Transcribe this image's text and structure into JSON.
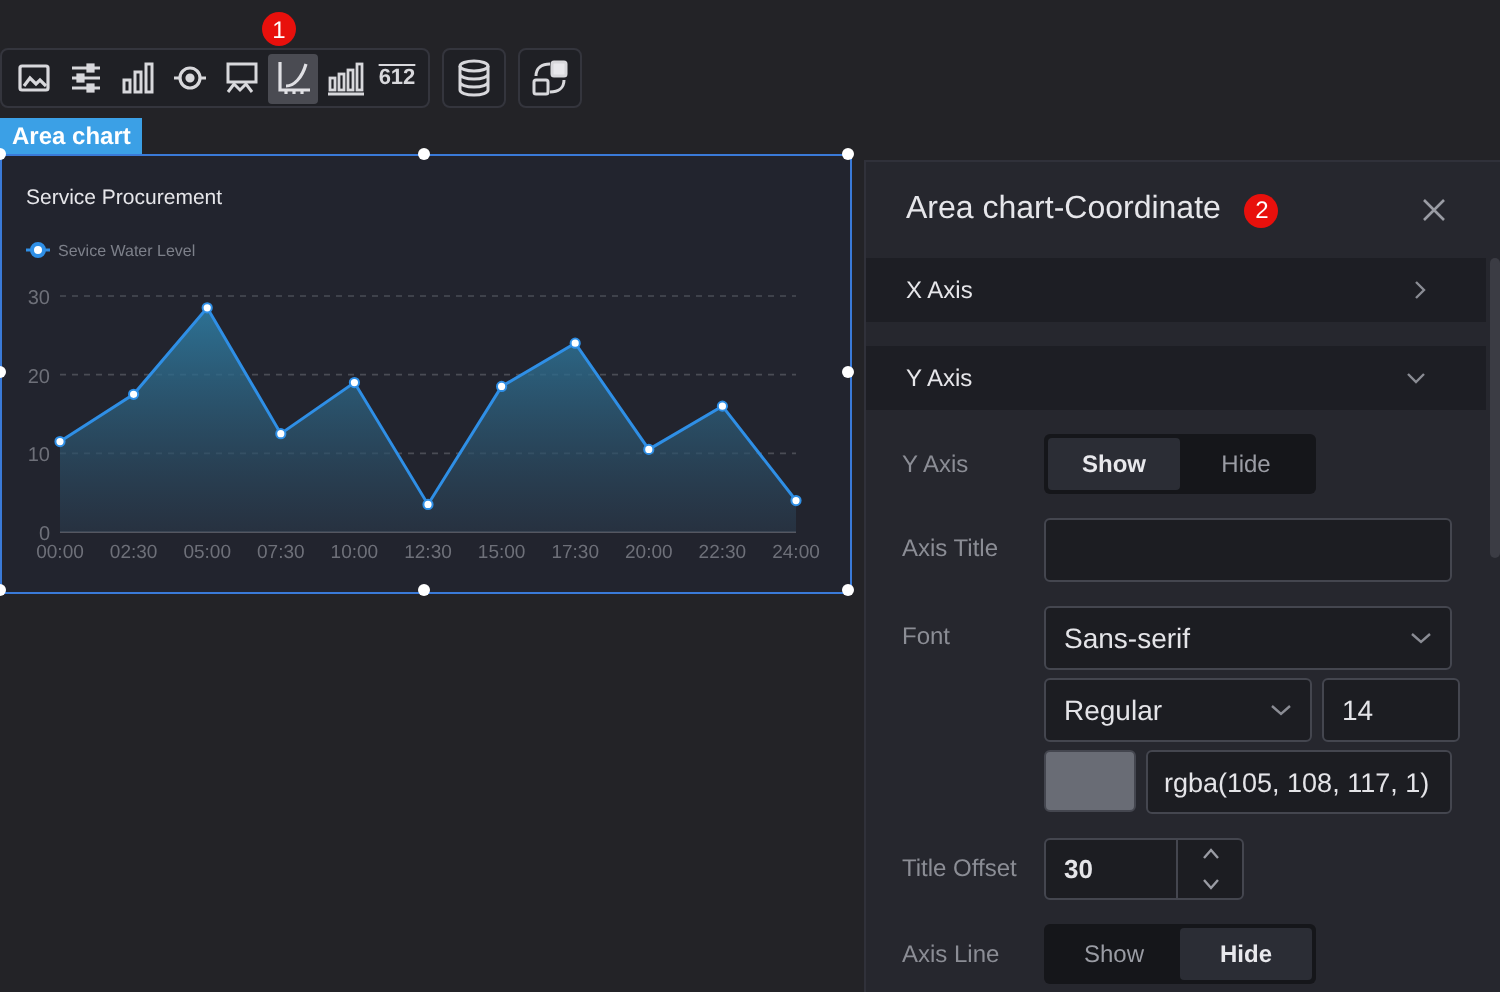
{
  "toolbar": {
    "badge": "1",
    "tools": [
      {
        "kind": "image",
        "selected": false
      },
      {
        "kind": "sliders",
        "selected": false
      },
      {
        "kind": "bars",
        "selected": false
      },
      {
        "kind": "target",
        "selected": false
      },
      {
        "kind": "screen",
        "selected": false
      },
      {
        "kind": "area",
        "selected": true
      },
      {
        "kind": "histogram",
        "selected": false
      },
      {
        "kind": "number",
        "label": "612",
        "selected": false
      }
    ],
    "extra_tools": [
      {
        "kind": "database"
      },
      {
        "kind": "link"
      }
    ]
  },
  "component_label": "Area chart",
  "chart": {
    "chart_data": {
      "type": "area",
      "title": "Service Procurement",
      "categories": [
        "00:00",
        "02:30",
        "05:00",
        "07:30",
        "10:00",
        "12:30",
        "15:00",
        "17:30",
        "20:00",
        "22:30",
        "24:00"
      ],
      "ylim": [
        0,
        30
      ],
      "yticks": [
        0,
        10,
        20,
        30
      ],
      "series": [
        {
          "name": "Sevice Water Level",
          "color": "#2f8fe6",
          "values": [
            11.5,
            17.5,
            28.5,
            12.5,
            19,
            3.5,
            18.5,
            24,
            10.5,
            16,
            4
          ]
        }
      ]
    }
  },
  "panel": {
    "title": "Area chart-Coordinate",
    "badge": "2",
    "sections": [
      {
        "title": "X Axis",
        "expanded": false
      },
      {
        "title": "Y Axis",
        "expanded": true,
        "fields": [
          {
            "kind": "toggle",
            "label": "Y Axis",
            "options": [
              {
                "label": "Show",
                "selected": true
              },
              {
                "label": "Hide",
                "selected": false
              }
            ]
          },
          {
            "kind": "input",
            "label": "Axis Title"
          },
          {
            "kind": "font",
            "label": "Font",
            "family": "Sans-serif",
            "weight": "Regular",
            "size": "14",
            "color": "#696c75",
            "color_text": "rgba(105, 108, 117, 1)"
          },
          {
            "kind": "stepper",
            "label": "Title Offset",
            "value": "30"
          },
          {
            "kind": "toggle",
            "label": "Axis Line",
            "options": [
              {
                "label": "Show",
                "selected": false
              },
              {
                "label": "Hide",
                "selected": true
              }
            ]
          }
        ]
      }
    ]
  }
}
